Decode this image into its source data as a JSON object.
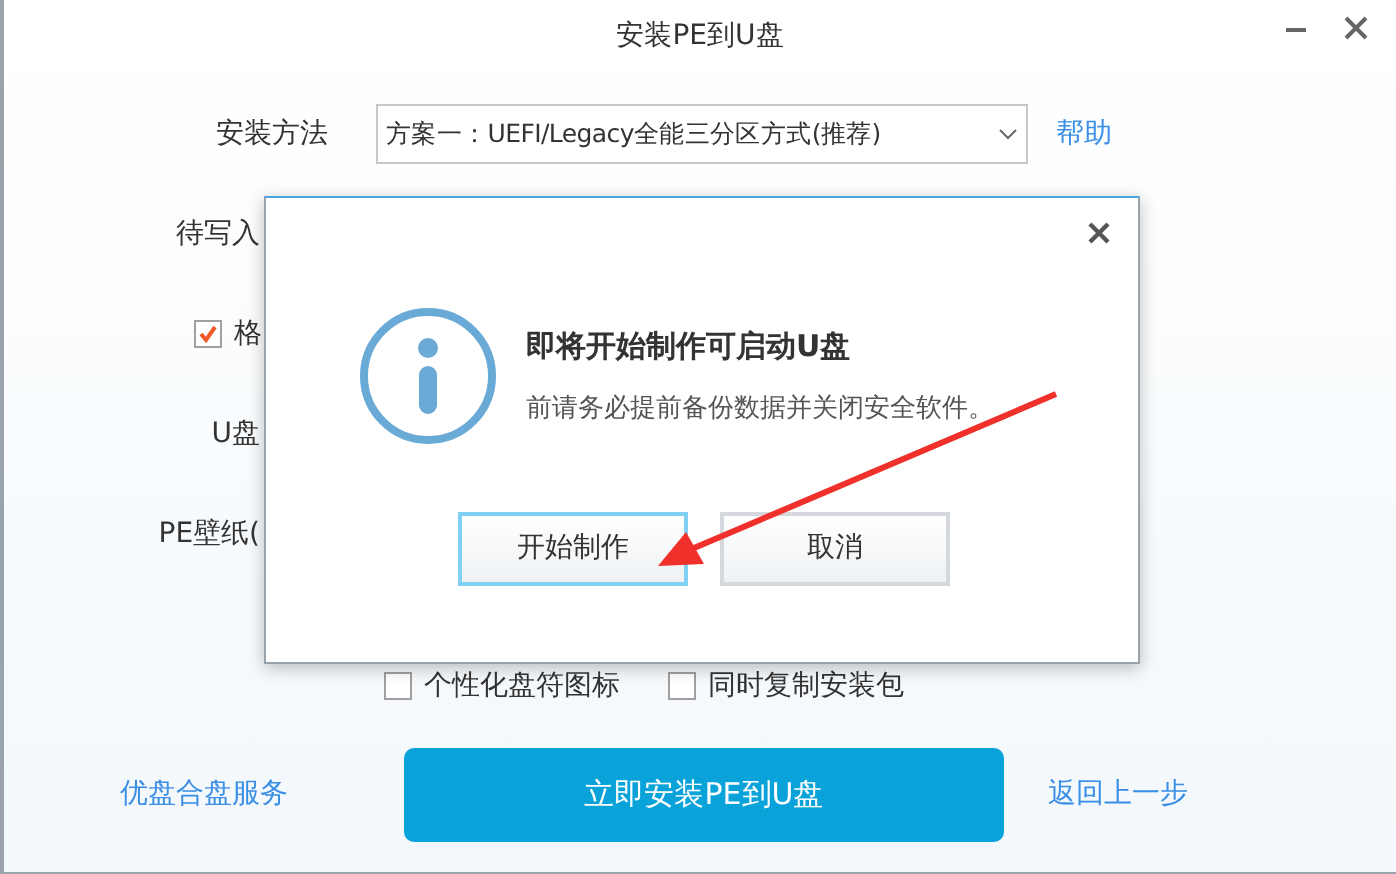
{
  "window": {
    "title": "安装PE到U盘"
  },
  "install_method": {
    "label": "安装方法",
    "value": "方案一：UEFI/Legacy全能三分区方式(推荐)",
    "help": "帮助"
  },
  "rows": [
    {
      "kind": "label",
      "label": "待写入"
    },
    {
      "kind": "checkbox",
      "label": "格",
      "checked": true
    },
    {
      "kind": "label",
      "label": "U盘"
    },
    {
      "kind": "label",
      "label": "PE壁纸("
    }
  ],
  "options": [
    {
      "label": "个性化盘符图标",
      "checked": false
    },
    {
      "label": "同时复制安装包",
      "checked": false
    }
  ],
  "footer": {
    "left_link": "优盘合盘服务",
    "primary": "立即安装PE到U盘",
    "right_link": "返回上一步"
  },
  "dialog": {
    "title": "即将开始制作可启动U盘",
    "message": "前请务必提前备份数据并关闭安全软件。",
    "buttons": [
      {
        "label": "开始制作",
        "selected": true
      },
      {
        "label": "取消",
        "selected": false
      }
    ]
  }
}
